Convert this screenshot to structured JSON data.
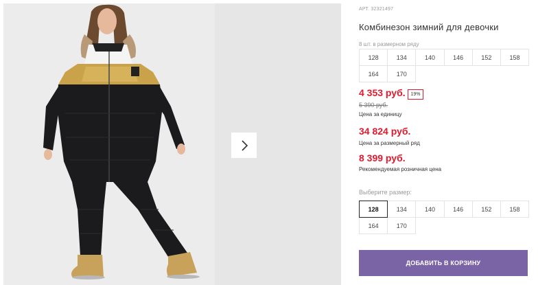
{
  "gallery": {
    "next_icon": "chevron-right-icon"
  },
  "product": {
    "article": "АРТ. 32321497",
    "title": "Комбинезон зимний для девочки",
    "row_label": "8 шт. в размерном ряду",
    "row_sizes": [
      "128",
      "134",
      "140",
      "146",
      "152",
      "158",
      "164",
      "170"
    ],
    "price": "4 353 руб.",
    "discount": "19%",
    "old_price": "5 390 руб.",
    "unit_caption": "Цена за единицу",
    "row_price": "34 824 руб.",
    "row_caption": "Цена за размерный ряд",
    "rrp_price": "8 399 руб.",
    "rrp_caption": "Рекомендуемая розничная цена",
    "choose_label": "Выберите размер:",
    "select_sizes": [
      "128",
      "134",
      "140",
      "146",
      "152",
      "158",
      "164",
      "170"
    ],
    "selected_size": "128",
    "cart_button": "ДОБАВИТЬ В КОРЗИНУ"
  },
  "colors": {
    "price": "#e01a2c",
    "button": "#7b64a6"
  }
}
